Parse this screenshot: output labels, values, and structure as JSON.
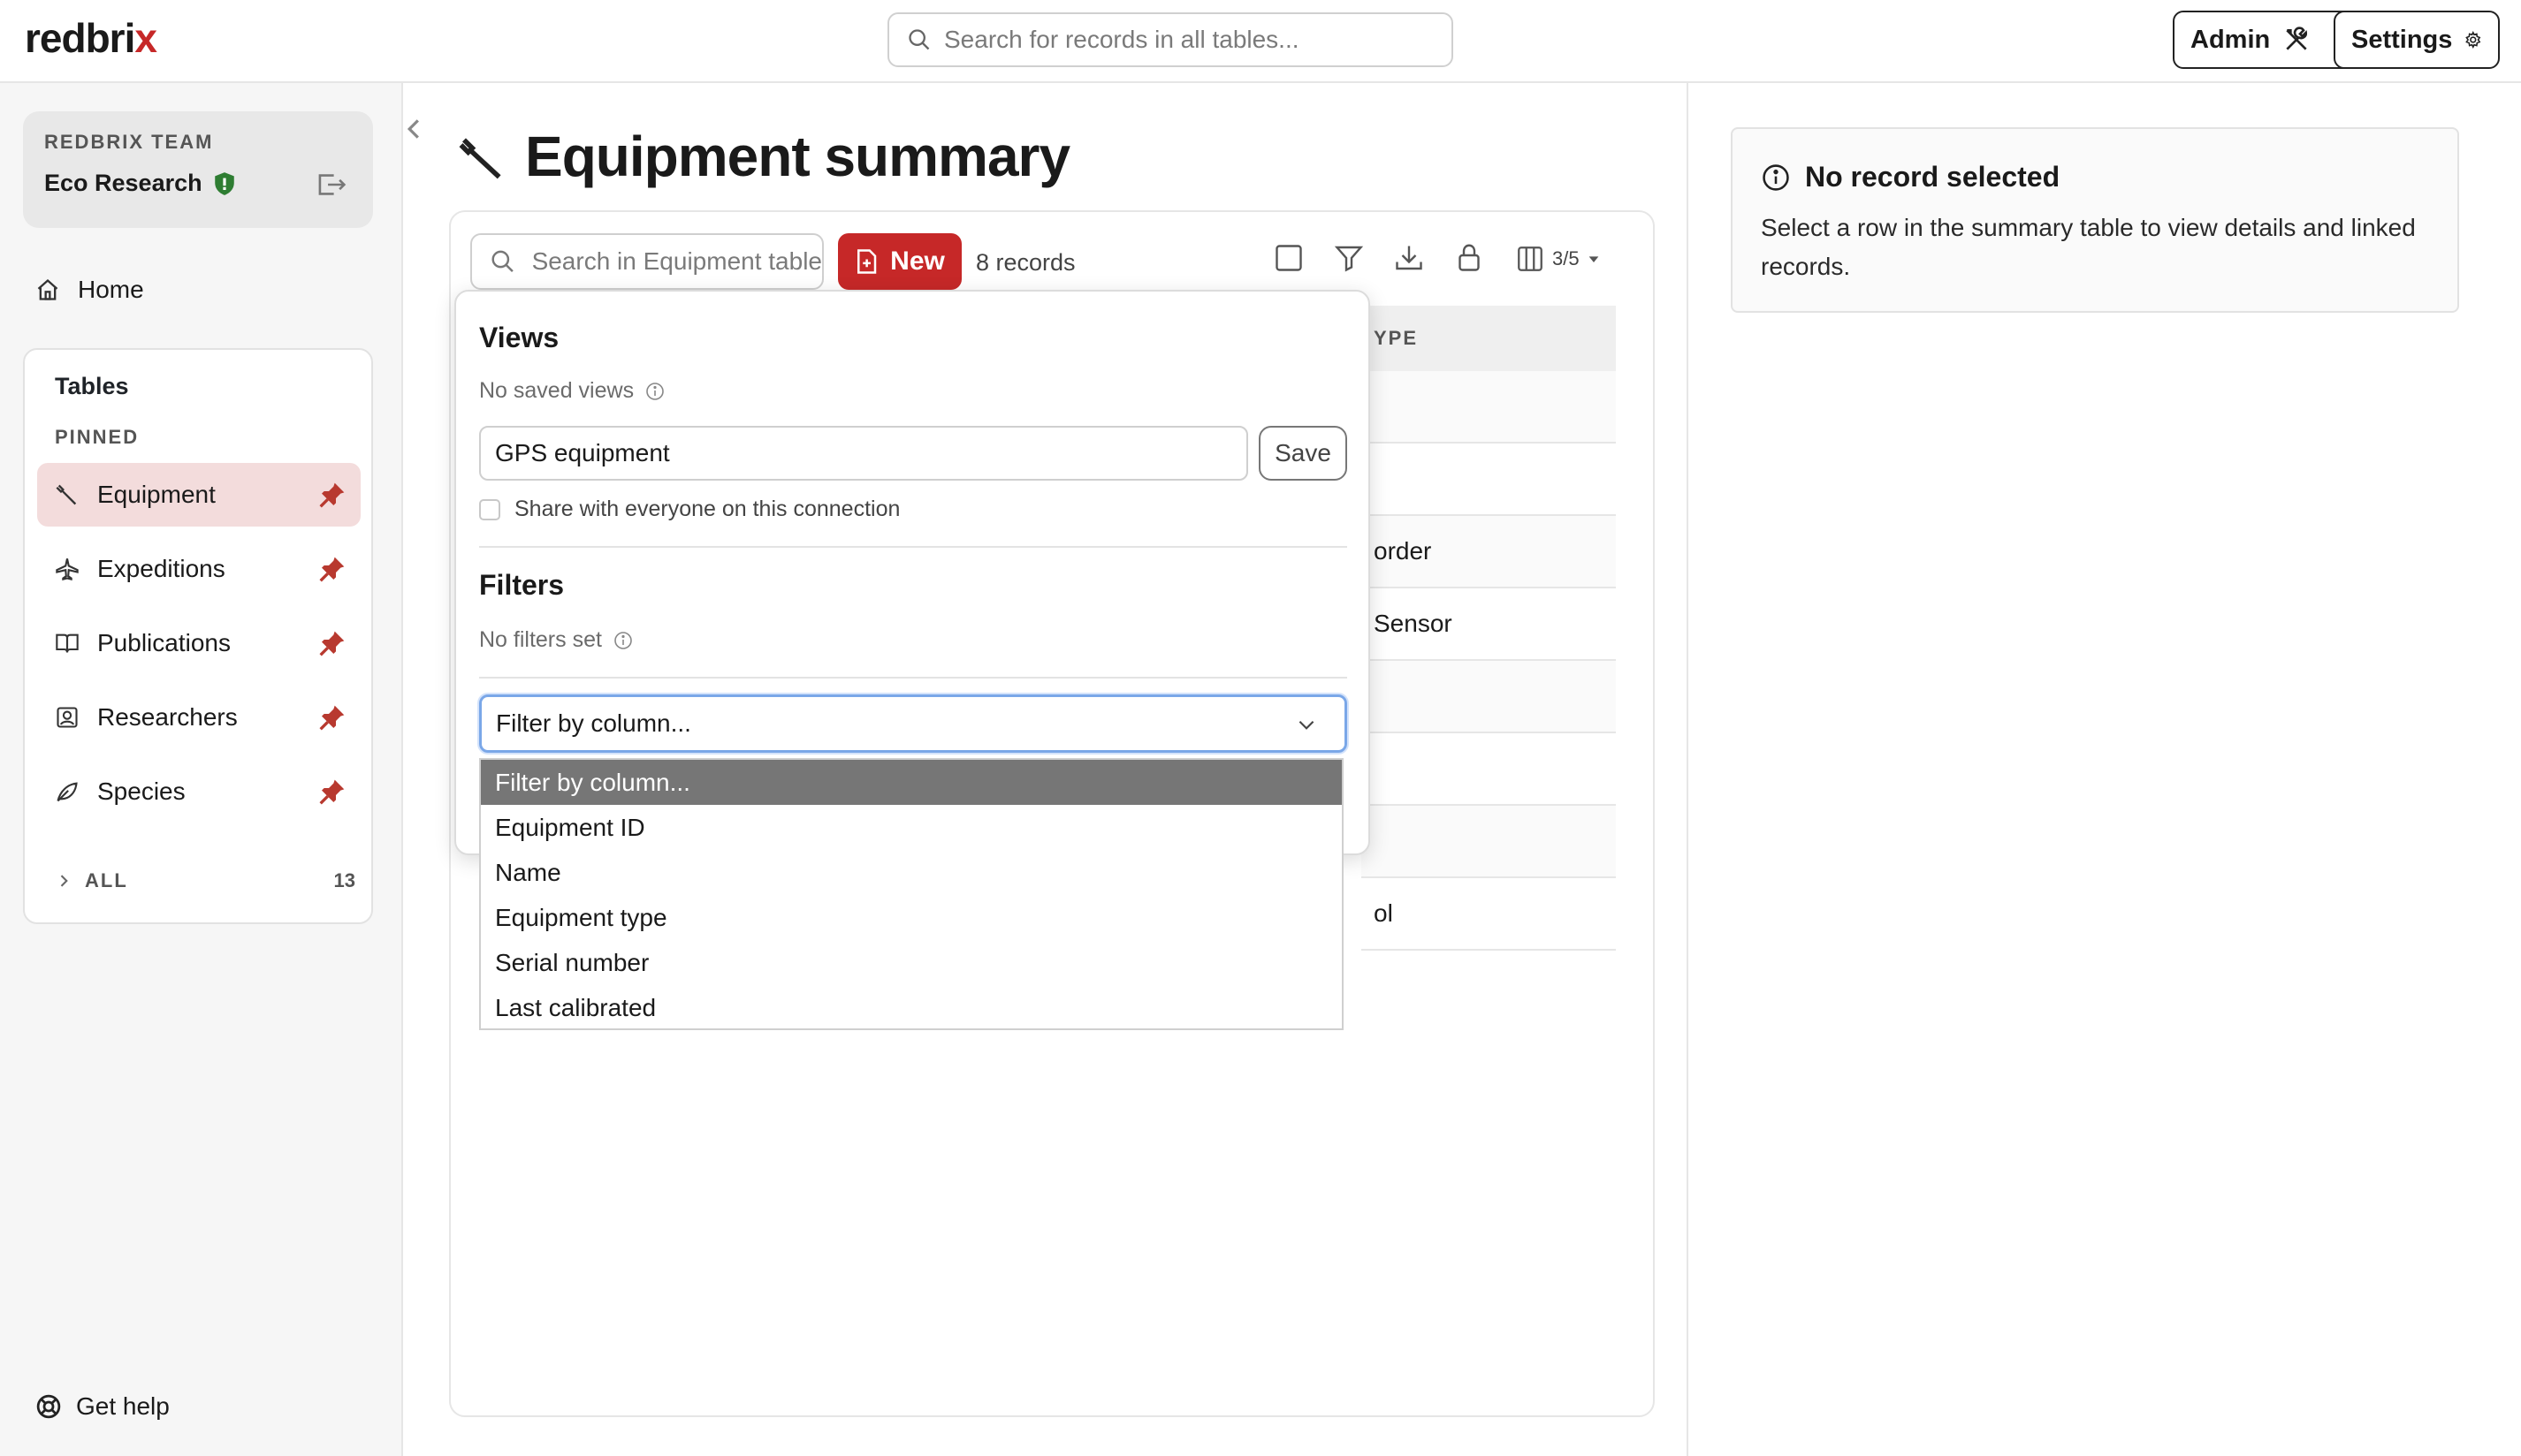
{
  "app": {
    "logo_main": "redbri",
    "logo_accent": "x"
  },
  "topbar": {
    "search_placeholder": "Search for records in all tables...",
    "admin_label": "Admin",
    "settings_label": "Settings"
  },
  "sidebar": {
    "team_label": "REDBRIX TEAM",
    "workspace_name": "Eco Research",
    "home_label": "Home",
    "tables_header": "Tables",
    "pinned_label": "PINNED",
    "items": [
      {
        "label": "Equipment",
        "icon": "wrench-icon",
        "active": true
      },
      {
        "label": "Expeditions",
        "icon": "plane-icon",
        "active": false
      },
      {
        "label": "Publications",
        "icon": "book-icon",
        "active": false
      },
      {
        "label": "Researchers",
        "icon": "person-badge-icon",
        "active": false
      },
      {
        "label": "Species",
        "icon": "leaf-icon",
        "active": false
      }
    ],
    "all_label": "ALL",
    "all_count": "13",
    "help_label": "Get help"
  },
  "main": {
    "title": "Equipment summary",
    "table_search_placeholder": "Search in Equipment table",
    "new_label": "New",
    "record_count": "8 records",
    "columns_indicator": "3/5",
    "visible_column_header": "YPE",
    "visible_cells": [
      "",
      "",
      "order",
      "Sensor",
      "",
      "",
      "",
      "ol"
    ]
  },
  "popover": {
    "views_header": "Views",
    "views_sub": "No saved views",
    "view_name_value": "GPS equipment",
    "save_label": "Save",
    "share_label": "Share with everyone on this connection",
    "share_checked": false,
    "filters_header": "Filters",
    "filters_sub": "No filters set",
    "filter_select_value": "Filter by column...",
    "filter_options": [
      "Filter by column...",
      "Equipment ID",
      "Name",
      "Equipment type",
      "Serial number",
      "Last calibrated"
    ],
    "highlighted_option": "Filter by column..."
  },
  "details": {
    "header": "No record selected",
    "body": "Select a row in the summary table to view details and linked records."
  },
  "colors": {
    "brand": "#c62828",
    "active_bg": "#f3dcdc",
    "focus_ring": "#7aa7e8",
    "option_highlight": "#767676"
  }
}
